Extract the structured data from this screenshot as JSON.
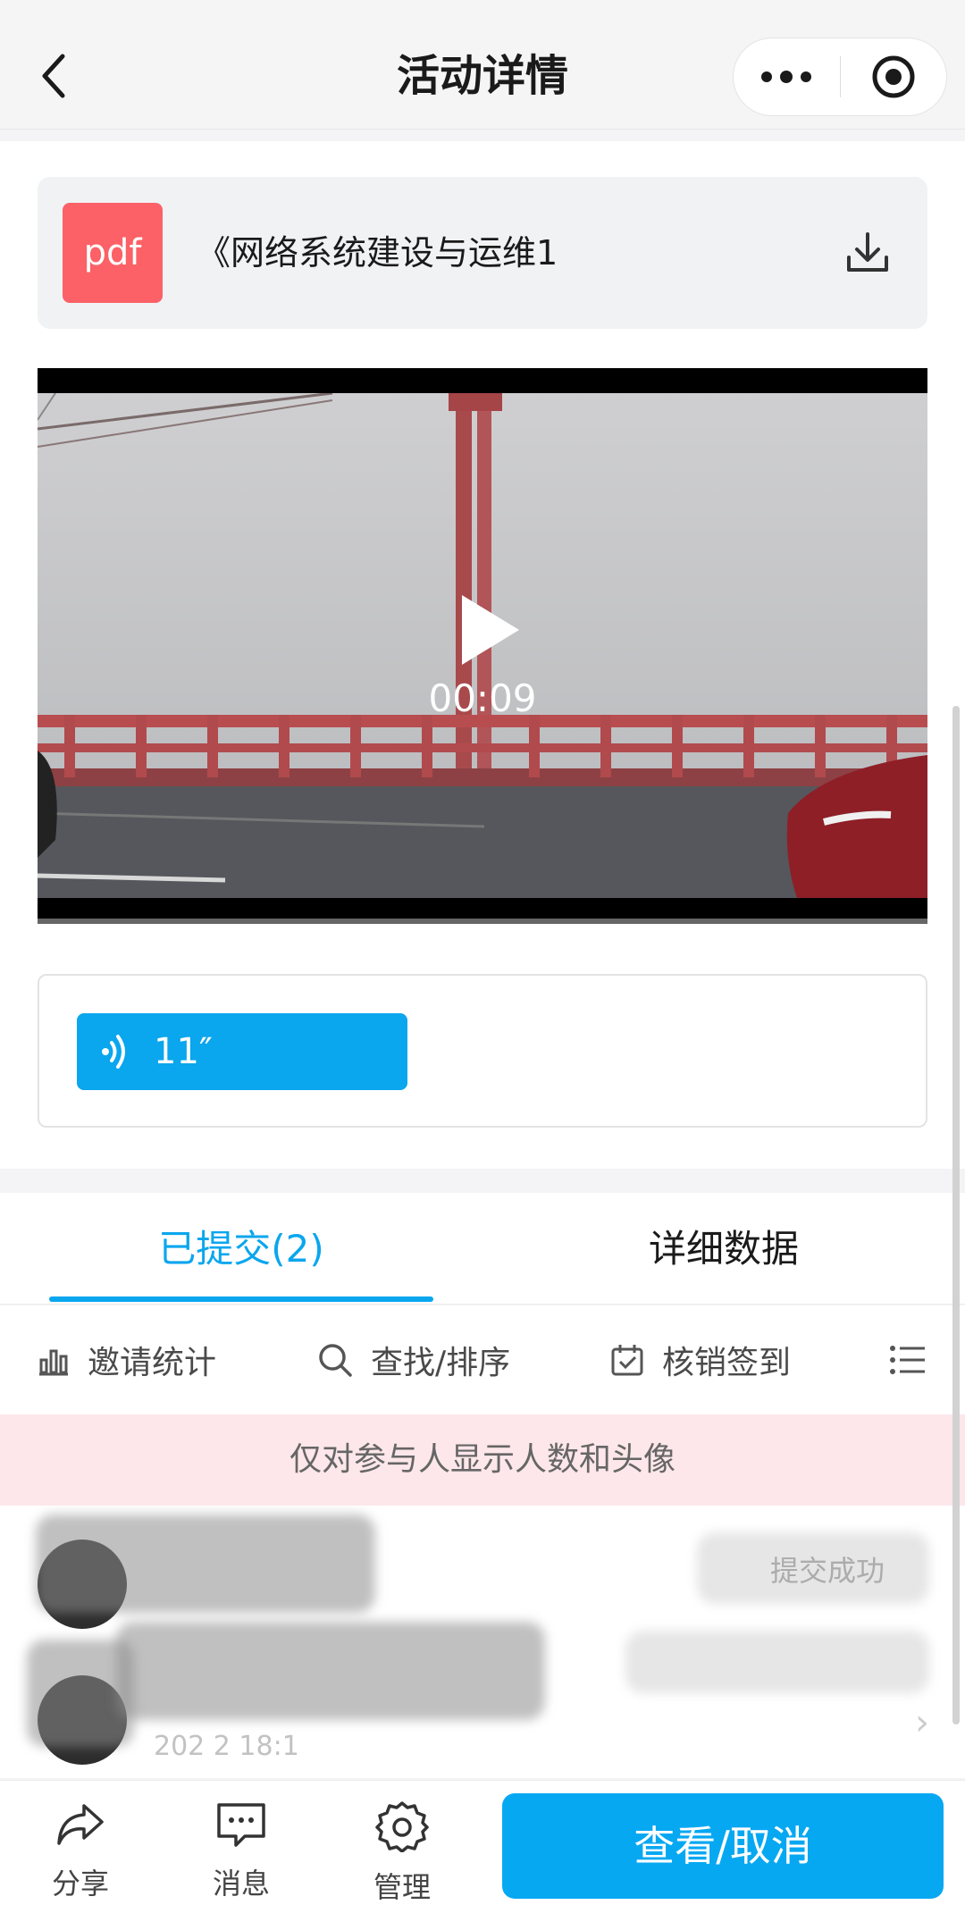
{
  "header": {
    "title": "活动详情"
  },
  "attachment": {
    "badge": "pdf",
    "name": "《网络系统建设与运维1"
  },
  "video": {
    "duration": "00:09"
  },
  "audio": {
    "length": "11″"
  },
  "tabs": [
    {
      "label": "已提交(2)",
      "active": true
    },
    {
      "label": "详细数据",
      "active": false
    }
  ],
  "toolbar": {
    "invite_stats": "邀请统计",
    "search_sort": "查找/排序",
    "verify_checkin": "核销签到"
  },
  "notice": "仅对参与人显示人数和头像",
  "participants": [
    {
      "status": "提交成功",
      "time": ""
    },
    {
      "status": "",
      "time": "202   2 18:1"
    }
  ],
  "bottom_nav": {
    "share": "分享",
    "message": "消息",
    "manage": "管理",
    "cta": "查看/取消"
  },
  "colors": {
    "accent": "#0aa6ee",
    "pdf": "#fb6166",
    "notice_bg": "#fde7ea"
  }
}
